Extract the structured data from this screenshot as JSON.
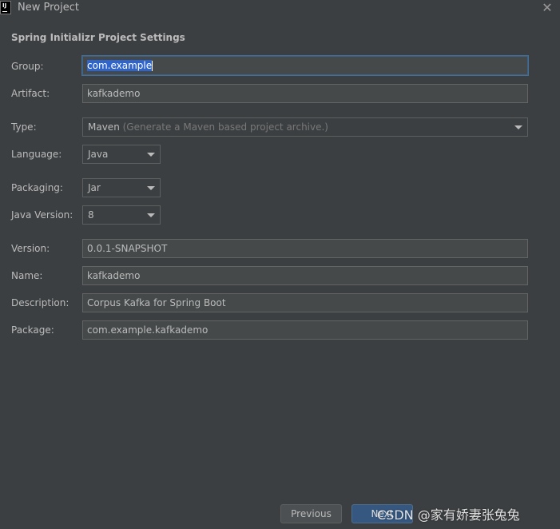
{
  "window": {
    "app_icon_text": "IJ",
    "title": "New Project",
    "close_glyph": "✕"
  },
  "section_title": "Spring Initializr Project Settings",
  "form": {
    "group": {
      "label": "Group:",
      "value": "com.example"
    },
    "artifact": {
      "label": "Artifact:",
      "value": "kafkademo"
    },
    "type": {
      "label": "Type:",
      "value": "Maven",
      "hint": "(Generate a Maven based project archive.)"
    },
    "language": {
      "label": "Language:",
      "value": "Java"
    },
    "packaging": {
      "label": "Packaging:",
      "value": "Jar"
    },
    "java_version": {
      "label": "Java Version:",
      "value": "8"
    },
    "version": {
      "label": "Version:",
      "value": "0.0.1-SNAPSHOT"
    },
    "name": {
      "label": "Name:",
      "value": "kafkademo"
    },
    "description": {
      "label": "Description:",
      "value": "Corpus Kafka for Spring Boot"
    },
    "package": {
      "label": "Package:",
      "value": "com.example.kafkademo"
    }
  },
  "buttons": {
    "previous": "Previous",
    "next": "Next"
  },
  "watermark": "CSDN @家有娇妻张兔兔",
  "colors": {
    "background": "#3c3f41",
    "field_background": "#45494a",
    "focus_border": "#466d94",
    "selection": "#2f65ca",
    "primary_button": "#365880"
  }
}
